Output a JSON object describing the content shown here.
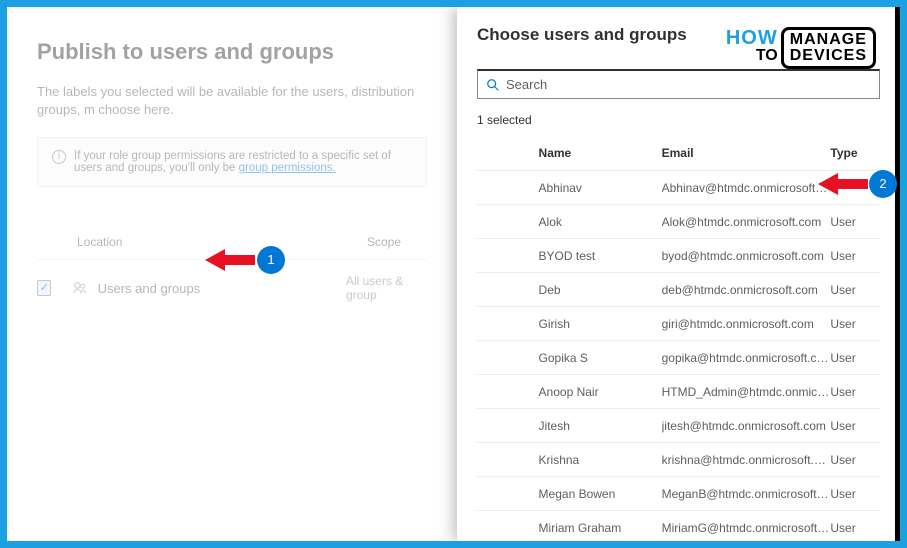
{
  "left": {
    "title": "Publish to users and groups",
    "description": "The labels you selected will be available for the users, distribution groups, m\nchoose here.",
    "infoText": "If your role group permissions are restricted to a specific set of users and groups, you'll only be",
    "infoLink": "group permissions.",
    "headers": {
      "location": "Location",
      "scope": "Scope"
    },
    "row": {
      "label": "Users and groups",
      "scope": "All users & group"
    }
  },
  "right": {
    "title": "Choose users and groups",
    "searchPlaceholder": "Search",
    "selectedText": "1 selected",
    "headers": {
      "name": "Name",
      "email": "Email",
      "type": "Type"
    },
    "rows": [
      {
        "name": "Abhinav",
        "email": "Abhinav@htmdc.onmicrosoft.com",
        "type": ""
      },
      {
        "name": "Alok",
        "email": "Alok@htmdc.onmicrosoft.com",
        "type": "User"
      },
      {
        "name": "BYOD test",
        "email": "byod@htmdc.onmicrosoft.com",
        "type": "User"
      },
      {
        "name": "Deb",
        "email": "deb@htmdc.onmicrosoft.com",
        "type": "User"
      },
      {
        "name": "Girish",
        "email": "giri@htmdc.onmicrosoft.com",
        "type": "User"
      },
      {
        "name": "Gopika S",
        "email": "gopika@htmdc.onmicrosoft.com",
        "type": "User"
      },
      {
        "name": "Anoop Nair",
        "email": "HTMD_Admin@htmdc.onmicrosof...",
        "type": "User"
      },
      {
        "name": "Jitesh",
        "email": "jitesh@htmdc.onmicrosoft.com",
        "type": "User"
      },
      {
        "name": "Krishna",
        "email": "krishna@htmdc.onmicrosoft.com",
        "type": "User"
      },
      {
        "name": "Megan Bowen",
        "email": "MeganB@htmdc.onmicrosoft.com",
        "type": "User"
      },
      {
        "name": "Miriam Graham",
        "email": "MiriamG@htmdc.onmicrosoft.com",
        "type": "User"
      }
    ]
  },
  "annotations": {
    "badge1": "1",
    "badge2": "2"
  },
  "logo": {
    "how": "HOW",
    "to": "TO",
    "manage": "MANAGE",
    "devices": "DEVICES"
  }
}
